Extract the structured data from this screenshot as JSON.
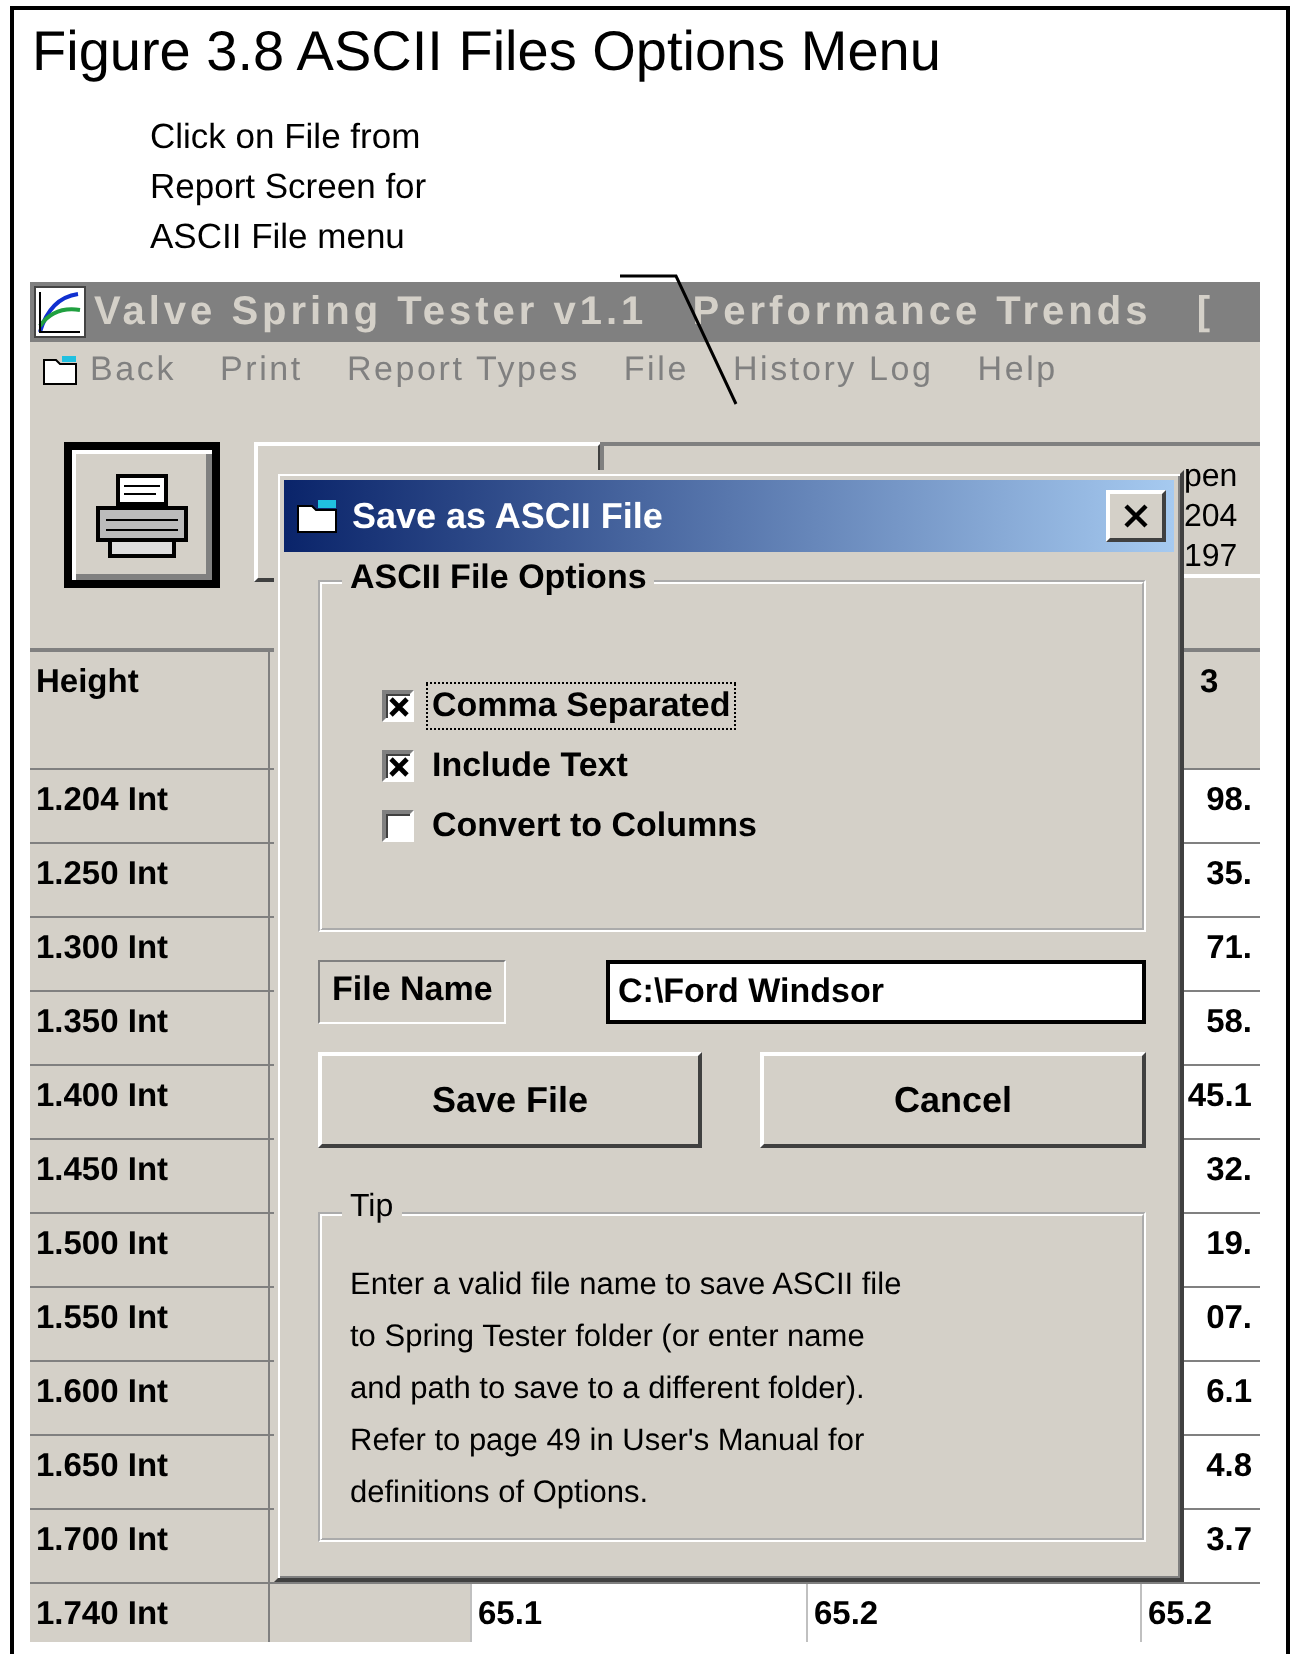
{
  "figure": {
    "caption": "Figure 3.8 ASCII Files Options Menu",
    "annotation": [
      "Click on File from",
      "Report Screen for",
      "ASCII File menu"
    ]
  },
  "window": {
    "title": "Valve Spring Tester v1.1   Performance Trends   [",
    "menu": [
      {
        "label": "Back",
        "kind": "icon"
      },
      {
        "label": "Print",
        "kind": "text"
      },
      {
        "label": "Report Types",
        "kind": "text"
      },
      {
        "label": "File",
        "kind": "text"
      },
      {
        "label": "History Log",
        "kind": "text"
      },
      {
        "label": "Help",
        "kind": "text"
      }
    ],
    "info_panel": [
      "pen",
      "204",
      "197"
    ],
    "table": {
      "header": {
        "label": "Height",
        "column_4": "3"
      },
      "rows": [
        {
          "label": "1.204 Int",
          "column_4": "98."
        },
        {
          "label": "1.250 Int",
          "column_4": "35."
        },
        {
          "label": "1.300 Int",
          "column_4": "71."
        },
        {
          "label": "1.350 Int",
          "column_4": "58."
        },
        {
          "label": "1.400 Int",
          "column_4": "45.1"
        },
        {
          "label": "1.450 Int",
          "column_4": "32."
        },
        {
          "label": "1.500 Int",
          "column_4": "19."
        },
        {
          "label": "1.550 Int",
          "column_4": "07."
        },
        {
          "label": "1.600 Int",
          "column_4": "6.1"
        },
        {
          "label": "1.650 Int",
          "column_4": "4.8"
        },
        {
          "label": "1.700 Int",
          "column_4": "3.7"
        },
        {
          "label": "1.740 Int",
          "column_2": "65.1",
          "column_3": "65.2",
          "column_4": "65.2"
        }
      ]
    }
  },
  "dialog": {
    "title": "Save as ASCII File",
    "options_title": "ASCII File Options",
    "options": [
      {
        "label": "Comma Separated",
        "checked": true,
        "focused": true
      },
      {
        "label": "Include Text",
        "checked": true,
        "focused": false
      },
      {
        "label": "Convert to Columns",
        "checked": false,
        "focused": false
      }
    ],
    "file_name_label": "File Name",
    "file_name": "C:\\Ford Windsor",
    "buttons": [
      "Save File",
      "Cancel"
    ],
    "tip_title": "Tip",
    "tip": [
      "Enter a valid file name to save ASCII file",
      "to Spring Tester folder (or enter name",
      "and path to save to a different folder).",
      "Refer to page 49 in User's Manual for",
      "definitions of Options."
    ]
  }
}
